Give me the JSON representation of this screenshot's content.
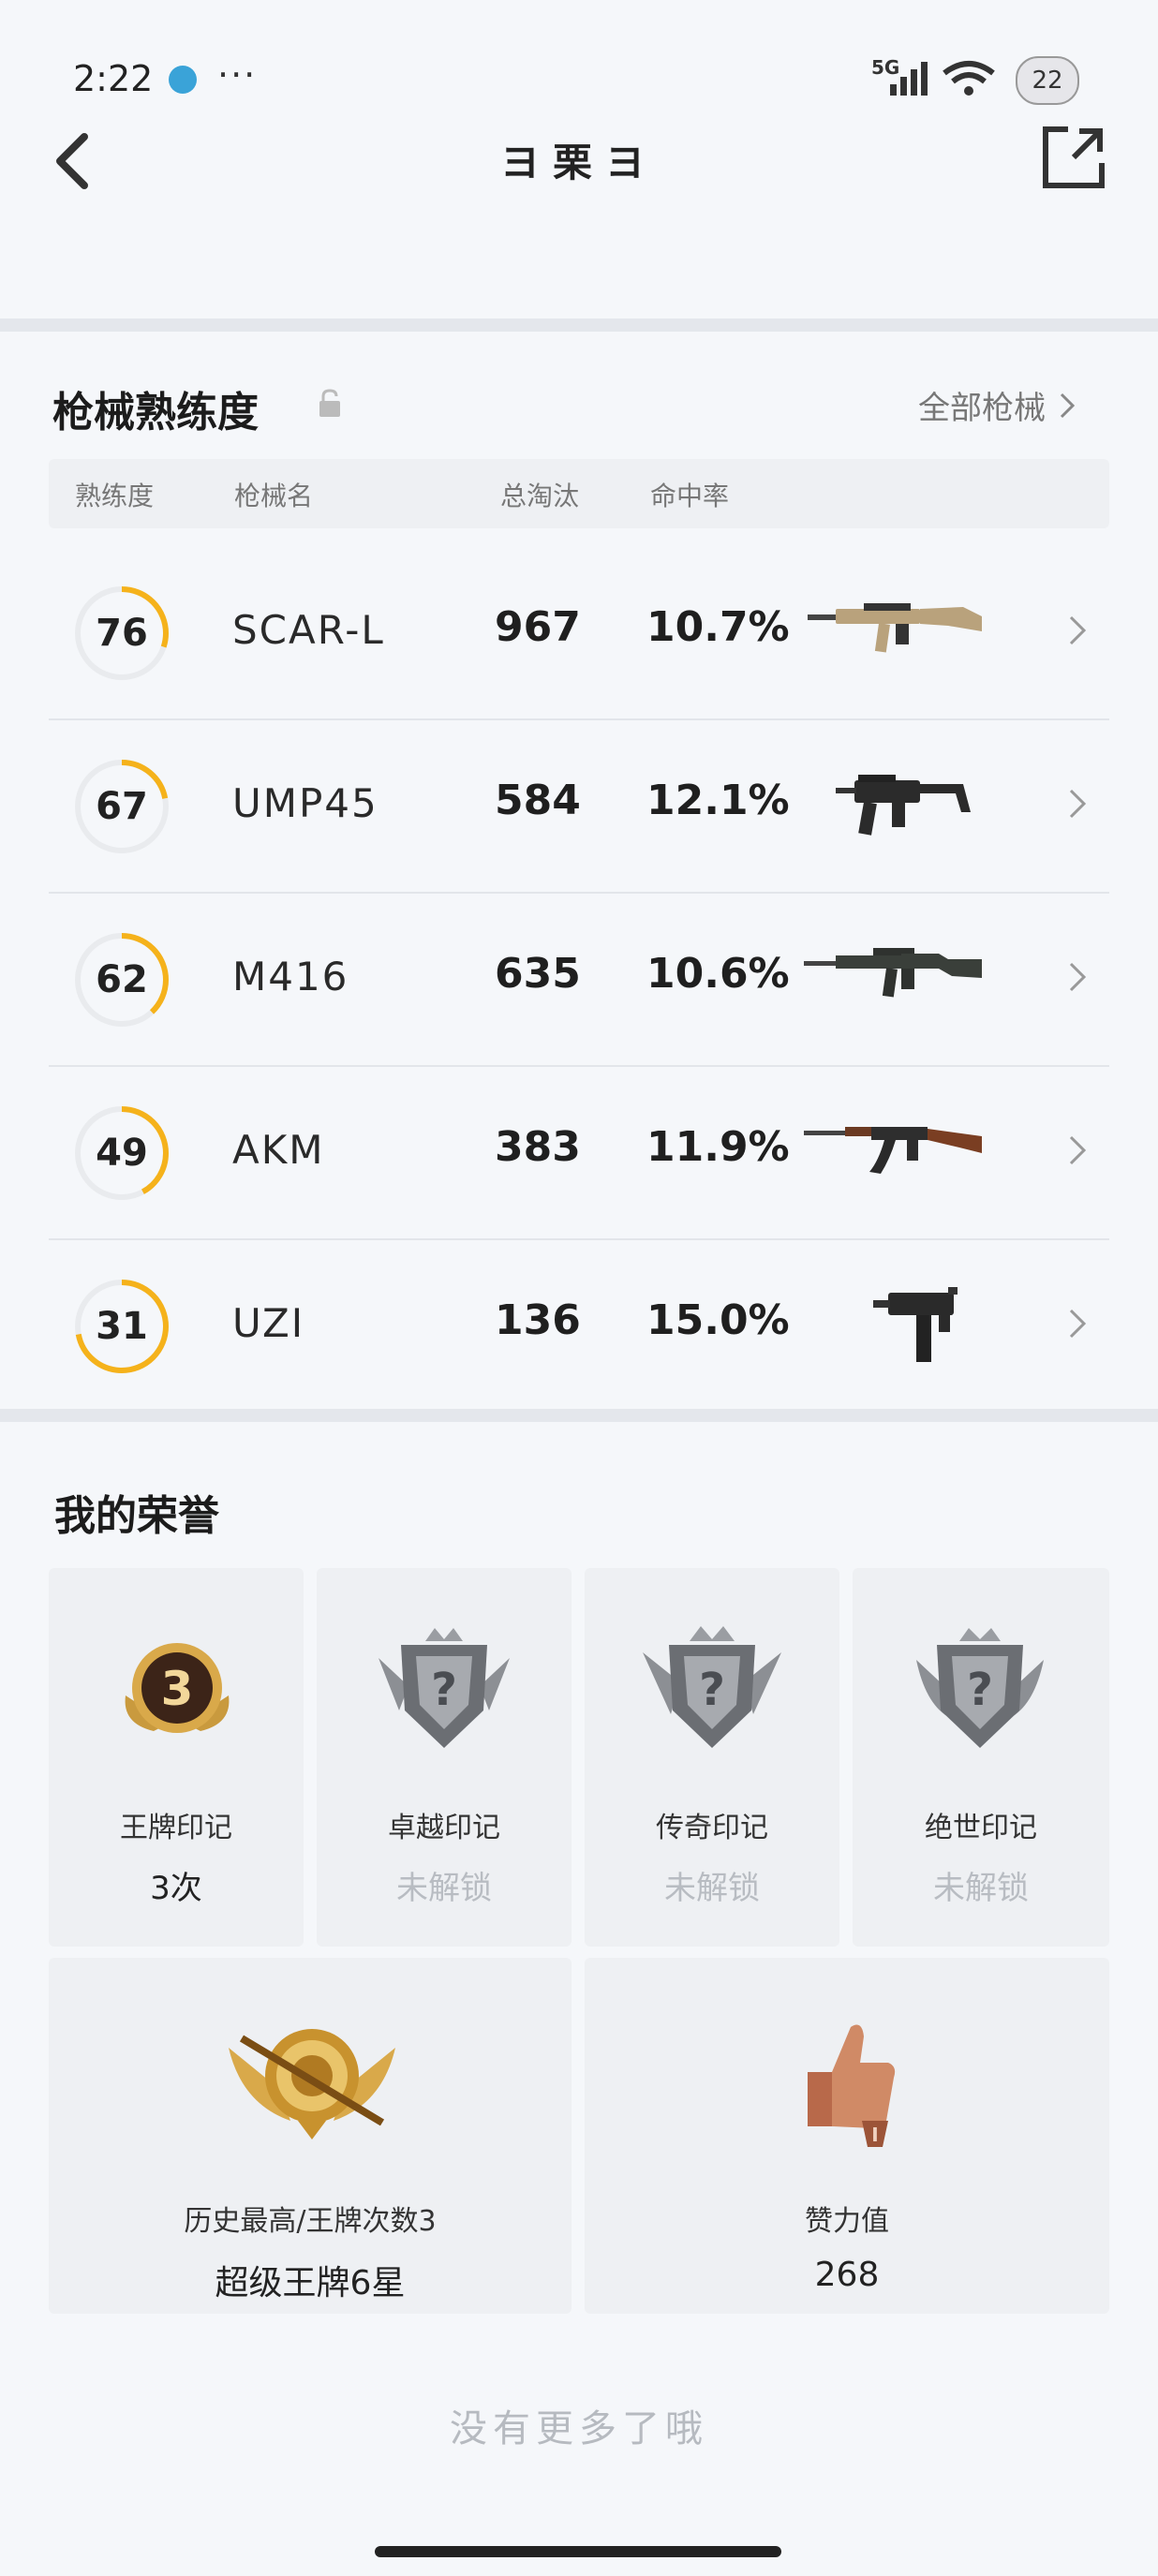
{
  "status_bar": {
    "time": "2:22",
    "network": "5G",
    "battery": "22"
  },
  "header": {
    "title": "ヨ栗ヨ"
  },
  "weapons": {
    "title": "枪械熟练度",
    "all_link": "全部枪械",
    "columns": {
      "proficiency": "熟练度",
      "name": "枪械名",
      "kills": "总淘汰",
      "hit_rate": "命中率"
    },
    "rows": [
      {
        "level": "76",
        "name": "SCAR-L",
        "kills": "967",
        "hit_rate": "10.7%",
        "progress": 0.3
      },
      {
        "level": "67",
        "name": "UMP45",
        "kills": "584",
        "hit_rate": "12.1%",
        "progress": 0.22
      },
      {
        "level": "62",
        "name": "M416",
        "kills": "635",
        "hit_rate": "10.6%",
        "progress": 0.38
      },
      {
        "level": "49",
        "name": "AKM",
        "kills": "383",
        "hit_rate": "11.9%",
        "progress": 0.42
      },
      {
        "level": "31",
        "name": "UZI",
        "kills": "136",
        "hit_rate": "15.0%",
        "progress": 0.72
      }
    ]
  },
  "honors": {
    "title": "我的荣誉",
    "badges": [
      {
        "label": "王牌印记",
        "value": "3次",
        "badge_number": "3",
        "locked": false
      },
      {
        "label": "卓越印记",
        "value": "未解锁",
        "badge_number": "?",
        "locked": true
      },
      {
        "label": "传奇印记",
        "value": "未解锁",
        "badge_number": "?",
        "locked": true
      },
      {
        "label": "绝世印记",
        "value": "未解锁",
        "badge_number": "?",
        "locked": true
      }
    ],
    "stats": [
      {
        "label": "历史最高/王牌次数3",
        "value": "超级王牌6星"
      },
      {
        "label": "赞力值",
        "value": "268"
      }
    ]
  },
  "footer": {
    "text": "没有更多了哦"
  },
  "colors": {
    "accent_ring": "#f5b21b",
    "ring_track": "#e9ebee"
  }
}
